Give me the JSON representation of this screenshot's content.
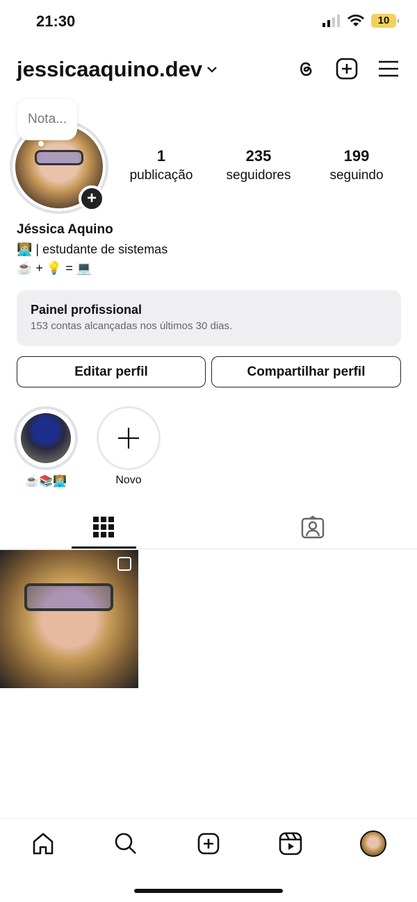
{
  "status": {
    "time": "21:30",
    "battery": "10"
  },
  "header": {
    "username": "jessicaaquino.dev"
  },
  "note": {
    "placeholder": "Nota..."
  },
  "stats": [
    {
      "value": "1",
      "label": "publicação"
    },
    {
      "value": "235",
      "label": "seguidores"
    },
    {
      "value": "199",
      "label": "seguindo"
    }
  ],
  "profile": {
    "name": "Jéssica Aquino",
    "bio_line1": "👩🏼‍💻 | estudante de sistemas",
    "bio_line2": "☕ + 💡 = 💻"
  },
  "panel": {
    "title": "Painel profissional",
    "subtitle": "153 contas alcançadas nos últimos 30 dias."
  },
  "buttons": {
    "edit": "Editar perfil",
    "share": "Compartilhar perfil"
  },
  "highlights": [
    {
      "label": "☕📚👩🏼‍💻"
    },
    {
      "label": "Novo"
    }
  ]
}
